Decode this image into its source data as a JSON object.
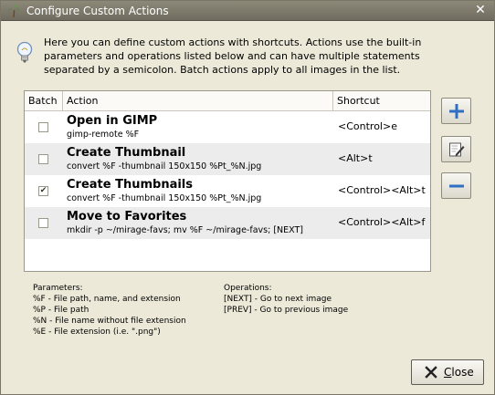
{
  "window": {
    "title": "Configure Custom Actions"
  },
  "info": {
    "text": "Here you can define custom actions with shortcuts. Actions use the built-in parameters and operations listed below and can have multiple statements separated by a semicolon. Batch actions apply to all images in the list."
  },
  "table": {
    "headers": {
      "batch": "Batch",
      "action": "Action",
      "shortcut": "Shortcut"
    },
    "rows": [
      {
        "batch": false,
        "name": "Open in GIMP",
        "command": "gimp-remote %F",
        "shortcut": "<Control>e"
      },
      {
        "batch": false,
        "name": "Create Thumbnail",
        "command": "convert %F -thumbnail 150x150 %Pt_%N.jpg",
        "shortcut": "<Alt>t"
      },
      {
        "batch": true,
        "name": "Create Thumbnails",
        "command": "convert %F -thumbnail 150x150 %Pt_%N.jpg",
        "shortcut": "<Control><Alt>t"
      },
      {
        "batch": false,
        "name": "Move to Favorites",
        "command": "mkdir -p ~/mirage-favs; mv %F ~/mirage-favs; [NEXT]",
        "shortcut": "<Control><Alt>f"
      }
    ]
  },
  "side_buttons": {
    "add_icon": "plus-icon",
    "edit_icon": "edit-icon",
    "remove_icon": "minus-icon"
  },
  "parameters": {
    "heading": "Parameters:",
    "items": [
      "%F - File path, name, and extension",
      "%P - File path",
      "%N - File name without file extension",
      "%E - File extension (i.e. \".png\")"
    ]
  },
  "operations": {
    "heading": "Operations:",
    "items": [
      "[NEXT] - Go to next image",
      "[PREV] - Go to previous image"
    ]
  },
  "close_button": {
    "mnemonic": "C",
    "rest": "lose"
  },
  "colors": {
    "titlebar": "#7f7c6e",
    "dialog_bg": "#ece9d8",
    "row_alt": "#ececec",
    "add_icon": "#2f6fc4",
    "remove_icon": "#2f6fc4"
  }
}
